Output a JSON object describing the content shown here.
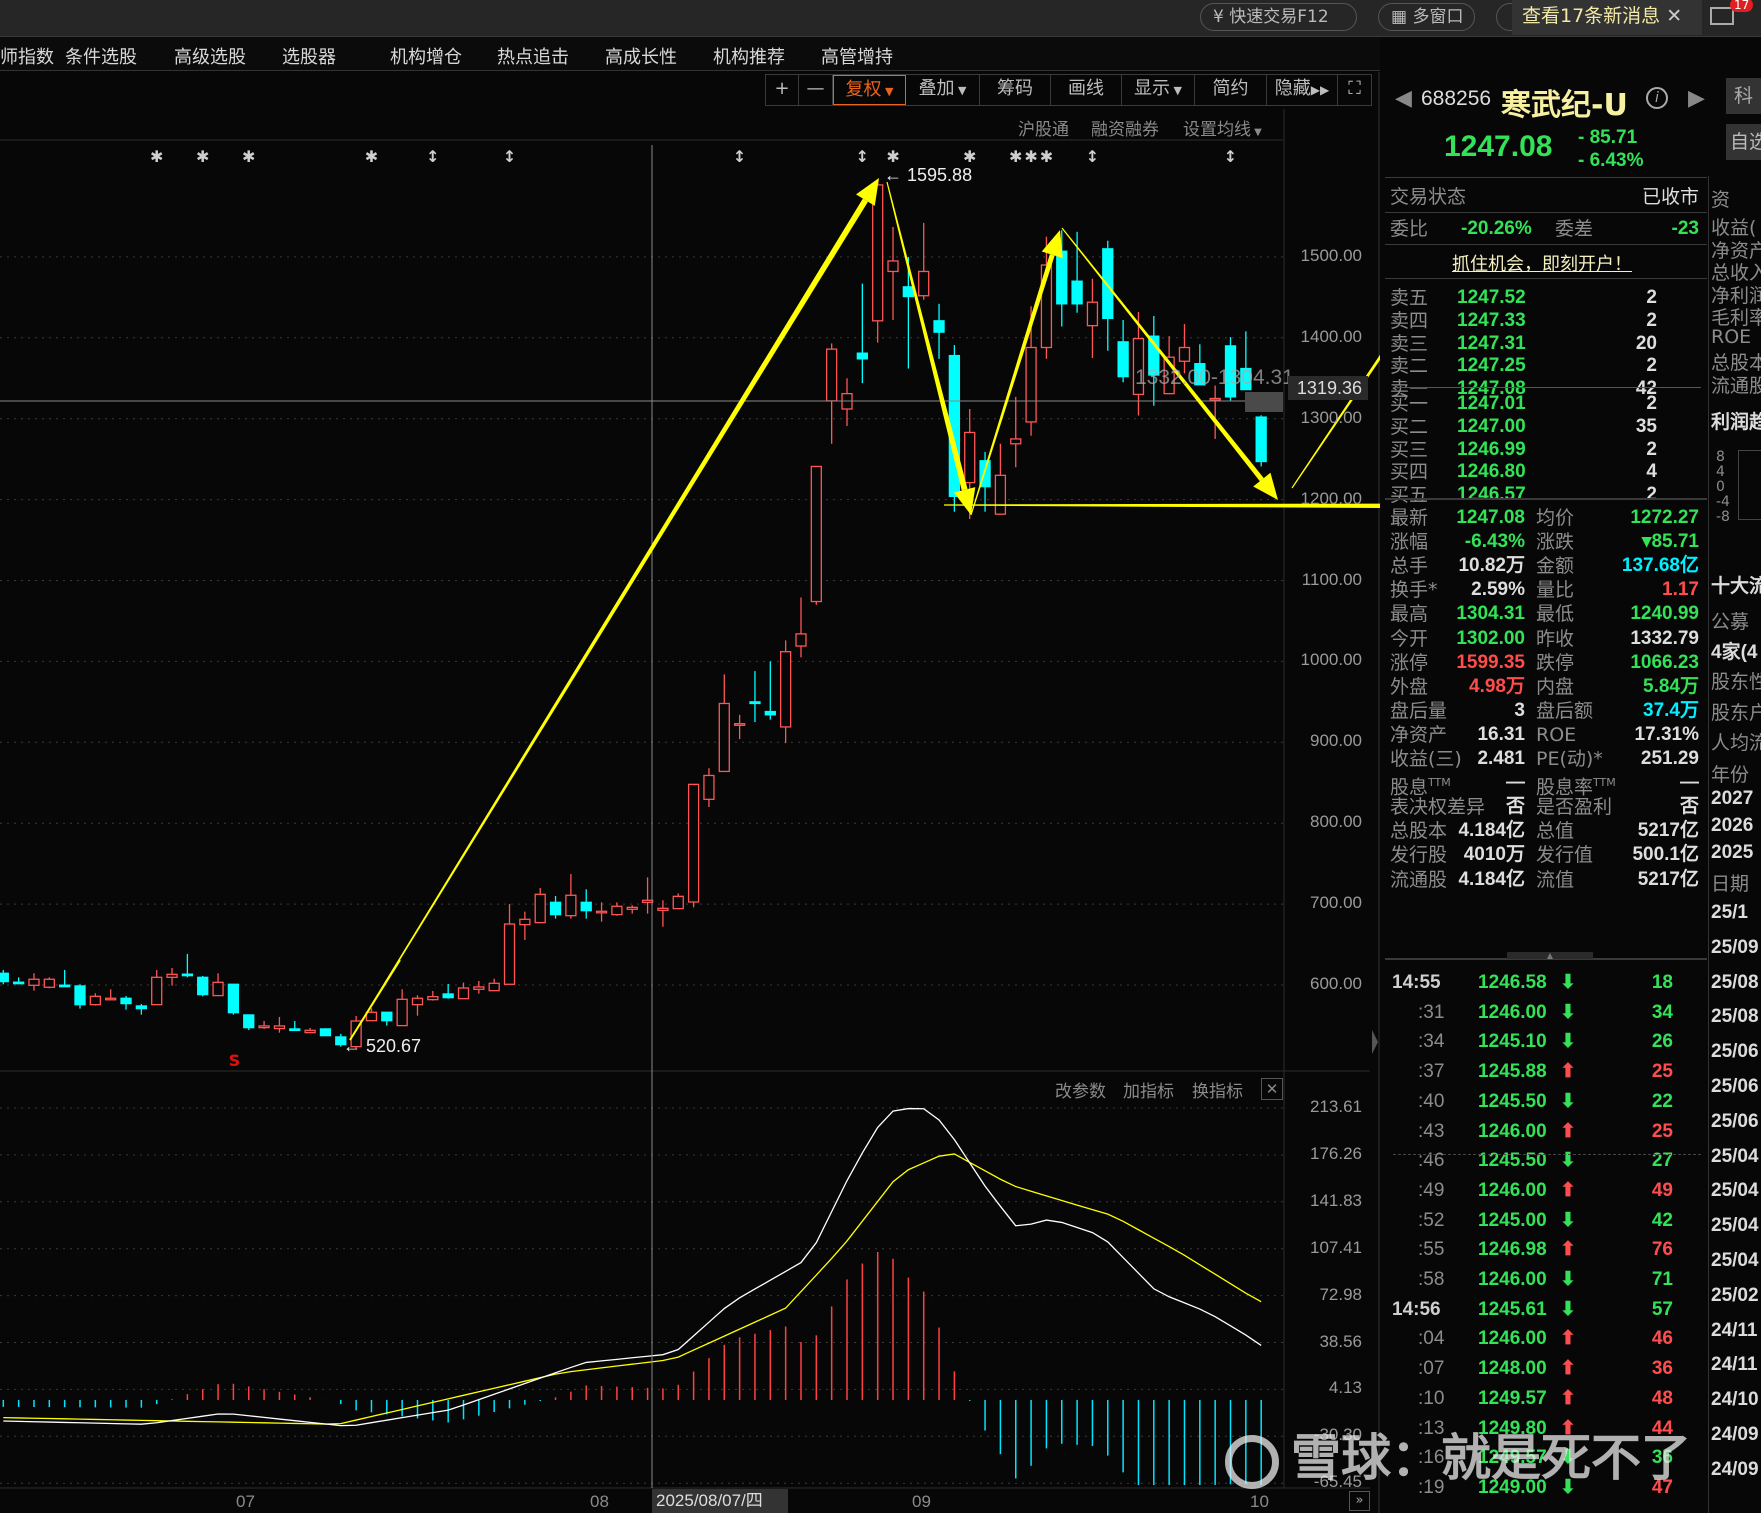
{
  "topbar": {
    "quick_trade": "快速交易F12",
    "multi_window": "多窗口",
    "messages": "查看17条新消息",
    "mail_badge": "17"
  },
  "menu": [
    "师指数",
    "条件选股",
    "高级选股",
    "选股器",
    "机构增仓",
    "热点追击",
    "高成长性",
    "机构推荐",
    "高管增持"
  ],
  "toolbar": {
    "zoom_in": "+",
    "zoom_out": "—",
    "buttons": [
      "复权",
      "叠加",
      "筹码",
      "画线",
      "显示",
      "简约",
      "隐藏"
    ],
    "sub": [
      "沪股通",
      "融资融券",
      "设置均线"
    ]
  },
  "main_chart": {
    "price_axis": [
      "1500.00",
      "1400.00",
      "1300.00",
      "1200.00",
      "1100.00",
      "1000.00",
      "900.00",
      "800.00",
      "700.00",
      "600.00"
    ],
    "cursor_price": "1319.36",
    "range_label": "1332.00-1304.31",
    "high_label": "1595.88",
    "low_label": "520.67",
    "sell_marker": "S",
    "colors": {
      "up": "#ff5555",
      "down": "#00ffff",
      "annotation": "#ffff00"
    },
    "event_markers": [
      {
        "idx": 10,
        "symbol": "✱"
      },
      {
        "idx": 13,
        "symbol": "✱"
      },
      {
        "idx": 16,
        "symbol": "✱"
      },
      {
        "idx": 24,
        "symbol": "✱"
      },
      {
        "idx": 28,
        "symbol": "↕"
      },
      {
        "idx": 33,
        "symbol": "↕"
      },
      {
        "idx": 48,
        "symbol": "↕"
      },
      {
        "idx": 56,
        "symbol": "↕"
      },
      {
        "idx": 58,
        "symbol": "✱"
      },
      {
        "idx": 63,
        "symbol": "✱"
      },
      {
        "idx": 66,
        "symbol": "✱"
      },
      {
        "idx": 67,
        "symbol": "✱"
      },
      {
        "idx": 68,
        "symbol": "✱"
      },
      {
        "idx": 71,
        "symbol": "↕"
      },
      {
        "idx": 80,
        "symbol": "↕"
      }
    ],
    "sell_marker_idx": 15,
    "kline_ohlc": [
      [
        614.5,
        618.6,
        600.9,
        604.2
      ],
      [
        603.5,
        609.5,
        600.9,
        603.3
      ],
      [
        599.6,
        614.5,
        593.0,
        607.1
      ],
      [
        597.2,
        609.5,
        595.9,
        607.1
      ],
      [
        599.8,
        618.6,
        598.8,
        599.6
      ],
      [
        598.8,
        600.9,
        570.8,
        575.7
      ],
      [
        575.7,
        589.8,
        574.5,
        586.0
      ],
      [
        583.4,
        594.7,
        582.7,
        583.6
      ],
      [
        583.6,
        586.4,
        569.6,
        577.0
      ],
      [
        574.1,
        576.6,
        563.4,
        570.8
      ],
      [
        575.7,
        618.6,
        575.7,
        609.5
      ],
      [
        609.5,
        621.0,
        599.2,
        613.2
      ],
      [
        613.4,
        638.4,
        609.5,
        613.2
      ],
      [
        609.5,
        611.2,
        586.0,
        588.1
      ],
      [
        586.9,
        614.5,
        586.9,
        603.3
      ],
      [
        600.9,
        600.9,
        563.4,
        565.8
      ],
      [
        563.0,
        563.0,
        544.4,
        547.3
      ],
      [
        547.3,
        555.5,
        545.7,
        549.4
      ],
      [
        546.1,
        560.5,
        541.1,
        549.4
      ],
      [
        545.7,
        555.5,
        544.0,
        544.0
      ],
      [
        541.1,
        546.9,
        541.1,
        544.0
      ],
      [
        545.7,
        546.5,
        537.0,
        537.4
      ],
      [
        535.8,
        539.5,
        523.8,
        526.3
      ],
      [
        523.8,
        561.7,
        520.67,
        555.5
      ],
      [
        555.9,
        571.2,
        555.9,
        566.3
      ],
      [
        566.3,
        566.3,
        549.8,
        555.9
      ],
      [
        549.8,
        594.7,
        549.8,
        582.3
      ],
      [
        575.7,
        587.3,
        562.1,
        583.6
      ],
      [
        581.9,
        592.6,
        580.7,
        585.6
      ],
      [
        588.9,
        601.3,
        583.1,
        584.4
      ],
      [
        583.1,
        603.0,
        583.1,
        596.3
      ],
      [
        594.7,
        605.0,
        589.3,
        597.6
      ],
      [
        593.0,
        607.9,
        593.0,
        602.1
      ],
      [
        600.9,
        700.1,
        600.9,
        675.4
      ],
      [
        674.6,
        690.7,
        655.7,
        681.2
      ],
      [
        677.1,
        719.9,
        676.3,
        712.1
      ],
      [
        702.2,
        710.0,
        682.0,
        687.0
      ],
      [
        685.7,
        737.2,
        682.0,
        710.9
      ],
      [
        702.2,
        718.3,
        682.0,
        691.9
      ],
      [
        689.4,
        702.2,
        678.3,
        691.1
      ],
      [
        687.0,
        702.2,
        685.7,
        697.3
      ],
      [
        693.6,
        698.5,
        688.2,
        696.0
      ],
      [
        702.2,
        733.1,
        688.2,
        704.7
      ],
      [
        692.3,
        704.7,
        672.1,
        694.8
      ],
      [
        694.4,
        713.3,
        693.6,
        709.6
      ],
      [
        702.6,
        848,
        696,
        848
      ],
      [
        829.5,
        868,
        820,
        859
      ],
      [
        864,
        984,
        864,
        948
      ],
      [
        921,
        934,
        904,
        923
      ],
      [
        950,
        988,
        925,
        948
      ],
      [
        938,
        1000,
        928,
        934
      ],
      [
        919,
        1026,
        899,
        1012
      ],
      [
        1019,
        1079,
        1005,
        1034
      ],
      [
        1074,
        1241,
        1070,
        1241
      ],
      [
        1322,
        1393,
        1269,
        1386
      ],
      [
        1312,
        1350,
        1291,
        1331
      ],
      [
        1381,
        1467,
        1344,
        1374
      ],
      [
        1421,
        1595.88,
        1394,
        1589
      ],
      [
        1482,
        1537,
        1422,
        1495
      ],
      [
        1463,
        1500,
        1362,
        1451
      ],
      [
        1452,
        1542,
        1447,
        1482
      ],
      [
        1421,
        1442,
        1374,
        1407
      ],
      [
        1378,
        1391,
        1185,
        1204
      ],
      [
        1221,
        1312,
        1176,
        1283
      ],
      [
        1248,
        1259,
        1185,
        1216
      ],
      [
        1182,
        1269,
        1182,
        1230
      ],
      [
        1269,
        1327,
        1240,
        1275
      ],
      [
        1296,
        1439,
        1279,
        1388
      ],
      [
        1388,
        1525,
        1374,
        1490
      ],
      [
        1507,
        1533,
        1414,
        1442
      ],
      [
        1470,
        1531,
        1431,
        1442
      ],
      [
        1415,
        1473,
        1375,
        1444
      ],
      [
        1510,
        1520,
        1384,
        1424
      ],
      [
        1395,
        1422,
        1345,
        1352
      ],
      [
        1330,
        1432,
        1304,
        1399
      ],
      [
        1402,
        1427,
        1316,
        1354
      ],
      [
        1331,
        1402,
        1331,
        1376
      ],
      [
        1371,
        1417,
        1356,
        1388
      ],
      [
        1368,
        1392,
        1342,
        1342
      ],
      [
        1323,
        1341,
        1275,
        1325
      ],
      [
        1390,
        1401,
        1322,
        1327
      ],
      [
        1362,
        1408,
        1336,
        1336
      ],
      [
        1302,
        1304.31,
        1240.99,
        1247.08
      ]
    ]
  },
  "indicator": {
    "buttons": [
      "改参数",
      "加指标",
      "换指标"
    ],
    "axis": [
      "213.61",
      "176.26",
      "141.83",
      "107.41",
      "72.98",
      "38.56",
      "4.13",
      "-30.30",
      "-65.45"
    ],
    "dif_anchors": [
      [
        0,
        -15.4
      ],
      [
        9.3,
        -17.8
      ],
      [
        14.4,
        -9.6
      ],
      [
        22.5,
        -19.4
      ],
      [
        29.1,
        -7.2
      ],
      [
        37.9,
        27.4
      ],
      [
        43.7,
        34.0
      ],
      [
        47.4,
        71.0
      ],
      [
        52.5,
        103.9
      ],
      [
        55.4,
        169.8
      ],
      [
        57.6,
        210.9
      ],
      [
        59.8,
        215.0
      ],
      [
        61.3,
        202.7
      ],
      [
        64.2,
        153.3
      ],
      [
        66.1,
        126.2
      ],
      [
        68.3,
        132.7
      ],
      [
        71.6,
        120.4
      ],
      [
        75.2,
        79.2
      ],
      [
        78.5,
        64.4
      ],
      [
        81.8,
        42.2
      ],
      [
        82,
        40
      ]
    ],
    "dea_anchors": [
      [
        0,
        -12.9
      ],
      [
        21.8,
        -17.8
      ],
      [
        36.4,
        20.0
      ],
      [
        43.7,
        29.9
      ],
      [
        51.0,
        67.3
      ],
      [
        54.7,
        112.2
      ],
      [
        58.4,
        165.7
      ],
      [
        61.7,
        182.1
      ],
      [
        65.7,
        157.4
      ],
      [
        69.3,
        145.1
      ],
      [
        72.3,
        135.2
      ],
      [
        76.7,
        108.1
      ],
      [
        81.8,
        72.7
      ],
      [
        82,
        72
      ]
    ],
    "colors": {
      "dif": "#ffffff",
      "dea": "#ffff00"
    }
  },
  "time_axis": {
    "labels": [
      "07",
      "08",
      "09",
      "10"
    ],
    "cursor_date": "2025/08/07/四"
  },
  "stock": {
    "code": "688256",
    "name": "寒武纪-U",
    "price": "1247.08",
    "change": "- 85.71",
    "change_pct": "- 6.43%",
    "tag_board": "科",
    "tag_watch": "自选",
    "status_label": "交易状态",
    "status": "已收市",
    "weibi_label": "委比",
    "weibi": "-20.26%",
    "weicha_label": "委差",
    "weicha": "-23",
    "promo": "抓住机会，即刻开户！"
  },
  "order_book": {
    "asks": [
      [
        "卖五",
        "1247.52",
        "2"
      ],
      [
        "卖四",
        "1247.33",
        "2"
      ],
      [
        "卖三",
        "1247.31",
        "20"
      ],
      [
        "卖二",
        "1247.25",
        "2"
      ],
      [
        "卖一",
        "1247.08",
        "42"
      ]
    ],
    "bids": [
      [
        "买一",
        "1247.01",
        "2"
      ],
      [
        "买二",
        "1247.00",
        "35"
      ],
      [
        "买三",
        "1246.99",
        "2"
      ],
      [
        "买四",
        "1246.80",
        "4"
      ],
      [
        "买五",
        "1246.57",
        "2"
      ]
    ]
  },
  "stats": [
    {
      "l1": "最新",
      "v1": "1247.08",
      "c1": "g",
      "l2": "均价",
      "v2": "1272.27",
      "c2": "g"
    },
    {
      "l1": "涨幅",
      "v1": "-6.43%",
      "c1": "g",
      "l2": "涨跌",
      "v2": "▾85.71",
      "c2": "g"
    },
    {
      "l1": "总手",
      "v1": "10.82万",
      "c1": "w",
      "l2": "金额",
      "v2": "137.68亿",
      "c2": "c"
    },
    {
      "l1": "换手*",
      "v1": "2.59%",
      "c1": "w",
      "l2": "量比",
      "v2": "1.17",
      "c2": "r"
    },
    {
      "l1": "最高",
      "v1": "1304.31",
      "c1": "g",
      "l2": "最低",
      "v2": "1240.99",
      "c2": "g"
    },
    {
      "l1": "今开",
      "v1": "1302.00",
      "c1": "g",
      "l2": "昨收",
      "v2": "1332.79",
      "c2": "w"
    },
    {
      "l1": "涨停",
      "v1": "1599.35",
      "c1": "r",
      "l2": "跌停",
      "v2": "1066.23",
      "c2": "g"
    },
    {
      "l1": "外盘",
      "v1": "4.98万",
      "c1": "r",
      "l2": "内盘",
      "v2": "5.84万",
      "c2": "g"
    },
    {
      "l1": "盘后量",
      "v1": "3",
      "c1": "w",
      "l2": "盘后额",
      "v2": "37.4万",
      "c2": "c"
    },
    {
      "l1": "净资产",
      "v1": "16.31",
      "c1": "w",
      "l2": "ROE",
      "v2": "17.31%",
      "c2": "w"
    },
    {
      "l1": "收益(三)",
      "v1": "2.481",
      "c1": "w",
      "l2": "PE(动)*",
      "v2": "251.29",
      "c2": "w"
    },
    {
      "l1": "股息",
      "s1": "TTM",
      "v1": "—",
      "c1": "w",
      "l2": "股息率",
      "s2": "TTM",
      "v2": "—",
      "c2": "w"
    },
    {
      "l1": "表决权差异",
      "v1": "否",
      "c1": "w",
      "l2": "是否盈利",
      "v2": "否",
      "c2": "w"
    },
    {
      "l1": "总股本",
      "v1": "4.184亿",
      "c1": "w",
      "l2": "总值",
      "v2": "5217亿",
      "c2": "w"
    },
    {
      "l1": "发行股",
      "v1": "4010万",
      "c1": "w",
      "l2": "发行值",
      "v2": "500.1亿",
      "c2": "w"
    },
    {
      "l1": "流通股",
      "v1": "4.184亿",
      "c1": "w",
      "l2": "流值",
      "v2": "5217亿",
      "c2": "w"
    }
  ],
  "ticks": [
    {
      "t": "14:55",
      "p": "1246.58",
      "d": "down",
      "v": "18",
      "vc": "g"
    },
    {
      "t": ":31",
      "p": "1246.00",
      "d": "down",
      "v": "34",
      "vc": "g"
    },
    {
      "t": ":34",
      "p": "1245.10",
      "d": "down",
      "v": "26",
      "vc": "g"
    },
    {
      "t": ":37",
      "p": "1245.88",
      "d": "up",
      "v": "25",
      "vc": "r"
    },
    {
      "t": ":40",
      "p": "1245.50",
      "d": "down",
      "v": "22",
      "vc": "g"
    },
    {
      "t": ":43",
      "p": "1246.00",
      "d": "up",
      "v": "25",
      "vc": "r"
    },
    {
      "t": ":46",
      "p": "1245.50",
      "d": "down",
      "v": "27",
      "vc": "g"
    },
    {
      "t": ":49",
      "p": "1246.00",
      "d": "up",
      "v": "49",
      "vc": "r"
    },
    {
      "t": ":52",
      "p": "1245.00",
      "d": "down",
      "v": "42",
      "vc": "g"
    },
    {
      "t": ":55",
      "p": "1246.98",
      "d": "up",
      "v": "76",
      "vc": "r"
    },
    {
      "t": ":58",
      "p": "1246.00",
      "d": "down",
      "v": "71",
      "vc": "g"
    },
    {
      "t": "14:56",
      "p": "1245.61",
      "d": "down",
      "v": "57",
      "vc": "g"
    },
    {
      "t": ":04",
      "p": "1246.00",
      "d": "up",
      "v": "46",
      "vc": "r"
    },
    {
      "t": ":07",
      "p": "1248.00",
      "d": "up",
      "v": "36",
      "vc": "r"
    },
    {
      "t": ":10",
      "p": "1249.57",
      "d": "up",
      "v": "48",
      "vc": "r"
    },
    {
      "t": ":13",
      "p": "1249.80",
      "d": "up",
      "v": "44",
      "vc": "r"
    },
    {
      "t": ":16",
      "p": "1249.57",
      "d": "down",
      "v": "36",
      "vc": "g"
    },
    {
      "t": ":19",
      "p": "1249.00",
      "d": "down",
      "v": "47",
      "vc": "r"
    }
  ],
  "side_column": {
    "top": [
      "资"
    ],
    "finance": [
      "收益(",
      "净资产",
      "总收入",
      "净利润",
      "毛利率",
      "ROE",
      "总股本",
      "流通股"
    ],
    "profit_trend": "利润趋",
    "trend_axis": [
      "8",
      "4",
      "0",
      "-4",
      "-8"
    ],
    "holders": [
      "十大流",
      "公募",
      "4家(4",
      "股东性",
      "股东户",
      "人均流"
    ],
    "year_header": "年份",
    "years": [
      "2027",
      "2026",
      "2025"
    ],
    "date_header": "日期",
    "dates": [
      "25/1",
      "25/09",
      "25/08",
      "25/08",
      "25/06",
      "25/06",
      "25/06",
      "25/04",
      "25/04",
      "25/04",
      "25/04",
      "25/02",
      "24/11",
      "24/11",
      "24/10",
      "24/09",
      "24/09"
    ]
  },
  "watermark": "雪球：就是死不了"
}
